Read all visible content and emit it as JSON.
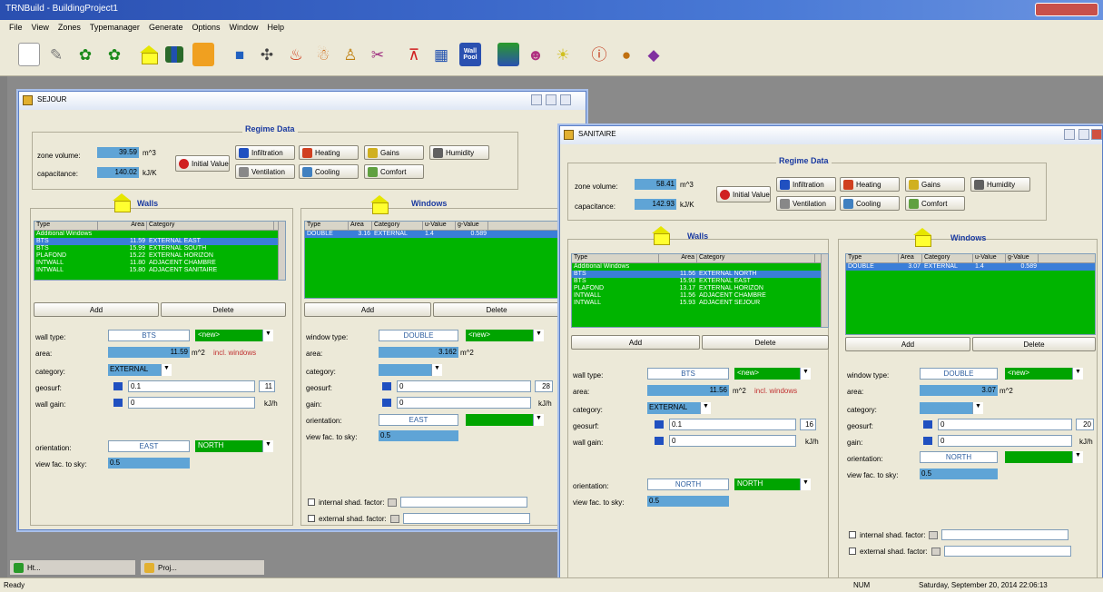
{
  "app": {
    "title": "TRNBuild - BuildingProject1"
  },
  "menu": [
    "File",
    "View",
    "Zones",
    "Typemanager",
    "Generate",
    "Options",
    "Window",
    "Help"
  ],
  "toolbar_icons": [
    "new-file-icon",
    "open-file-icon",
    "zone-green-icon",
    "zone-green-alt-icon",
    "house-yellow-icon",
    "layers-icon",
    "house-orange-icon",
    "walls-blue-icon",
    "ventilation-icon",
    "heating-fire-icon",
    "comfort-person-icon",
    "gains-lamp-icon",
    "tools-icon",
    "orientation-icon",
    "chart-icon",
    "wall-pool-icon",
    "building-icon",
    "people-icon",
    "sun-icon",
    "info-icon",
    "globe-icon",
    "help-book-icon"
  ],
  "wallpool_label": "Wall Pool",
  "sejour": {
    "title": "SEJOUR",
    "regime": {
      "title": "Regime Data",
      "zone_volume_label": "zone volume:",
      "zone_volume": "39.59",
      "volume_unit": "m^3",
      "capacitance_label": "capacitance:",
      "capacitance": "140.02",
      "capacitance_unit": "kJ/K",
      "initial_values": "Initial Values",
      "infiltration": "Infiltration",
      "ventilation": "Ventilation",
      "heating": "Heating",
      "cooling": "Cooling",
      "gains": "Gains",
      "comfort": "Comfort",
      "humidity": "Humidity"
    },
    "walls": {
      "title": "Walls",
      "columns": [
        "Type",
        "Area",
        "Category"
      ],
      "rows": [
        {
          "type": "Additional Windows",
          "area": "",
          "category": "",
          "sel": false
        },
        {
          "type": "BTS",
          "area": "11.59",
          "category": "EXTERNAL EAST",
          "sel": true
        },
        {
          "type": "BTS",
          "area": "15.99",
          "category": "EXTERNAL SOUTH",
          "sel": false
        },
        {
          "type": "PLAFOND",
          "area": "15.22",
          "category": "EXTERNAL HORIZON",
          "sel": false
        },
        {
          "type": "INTWALL",
          "area": "11.80",
          "category": "ADJACENT CHAMBRE",
          "sel": false
        },
        {
          "type": "INTWALL",
          "area": "15.80",
          "category": "ADJACENT SANITAIRE",
          "sel": false
        }
      ],
      "add": "Add",
      "delete": "Delete",
      "wall_type_label": "wall type:",
      "wall_type": "BTS",
      "dropdown_new": "<new>",
      "area_label": "area:",
      "area": "11.59",
      "area_unit": "m^2",
      "incl_windows": "incl. windows",
      "category_label": "category:",
      "category": "EXTERNAL",
      "geosurf_label": "geosurf:",
      "geosurf": "0.1",
      "geosurf_right": "11",
      "wallgain_label": "wall gain:",
      "wallgain": "0",
      "wallgain_unit": "kJ/h",
      "orientation_label": "orientation:",
      "orientation": "EAST",
      "orientation_dd": "NORTH",
      "viewfac_label": "view fac. to sky:",
      "viewfac": "0.5"
    },
    "windows": {
      "title": "Windows",
      "columns": [
        "Type",
        "Area",
        "Category",
        "u-Value",
        "g-Value"
      ],
      "rows": [
        {
          "type": "DOUBLE",
          "area": "3.16",
          "category": "EXTERNAL",
          "u": "1.4",
          "g": "0.589",
          "sel": true
        }
      ],
      "add": "Add",
      "delete": "Delete",
      "window_type_label": "window type:",
      "window_type": "DOUBLE",
      "dropdown_new": "<new>",
      "area_label": "area:",
      "area": "3.162",
      "area_unit": "m^2",
      "category_label": "category:",
      "category": "EXTERNAL",
      "geosurf_label": "geosurf:",
      "geosurf": "0",
      "geosurf_right": "28",
      "gain_label": "gain:",
      "gain": "0",
      "gain_unit": "kJ/h",
      "orientation_label": "orientation:",
      "orientation": "EAST",
      "orientation_dd": "EAST",
      "viewfac_label": "view fac. to sky:",
      "viewfac": "0.5",
      "internal_shad": "internal shad. factor:",
      "external_shad": "external shad. factor:"
    }
  },
  "sanitaire": {
    "title": "SANITAIRE",
    "regime": {
      "title": "Regime Data",
      "zone_volume_label": "zone volume:",
      "zone_volume": "58.41",
      "volume_unit": "m^3",
      "capacitance_label": "capacitance:",
      "capacitance": "142.93",
      "capacitance_unit": "kJ/K",
      "initial_values": "Initial Values",
      "infiltration": "Infiltration",
      "ventilation": "Ventilation",
      "heating": "Heating",
      "cooling": "Cooling",
      "gains": "Gains",
      "comfort": "Comfort",
      "humidity": "Humidity"
    },
    "walls": {
      "title": "Walls",
      "columns": [
        "Type",
        "Area",
        "Category"
      ],
      "rows": [
        {
          "type": "Additional Windows",
          "area": "",
          "category": "",
          "sel": false
        },
        {
          "type": "BTS",
          "area": "11.56",
          "category": "EXTERNAL NORTH",
          "sel": true
        },
        {
          "type": "BTS",
          "area": "15.93",
          "category": "EXTERNAL EAST",
          "sel": false
        },
        {
          "type": "PLAFOND",
          "area": "13.17",
          "category": "EXTERNAL HORIZON",
          "sel": false
        },
        {
          "type": "INTWALL",
          "area": "11.56",
          "category": "ADJACENT CHAMBRE",
          "sel": false
        },
        {
          "type": "INTWALL",
          "area": "15.93",
          "category": "ADJACENT SEJOUR",
          "sel": false
        }
      ],
      "add": "Add",
      "delete": "Delete",
      "wall_type_label": "wall type:",
      "wall_type": "BTS",
      "dropdown_new": "<new>",
      "area_label": "area:",
      "area": "11.56",
      "area_unit": "m^2",
      "incl_windows": "incl. windows",
      "category_label": "category:",
      "category": "EXTERNAL",
      "geosurf_label": "geosurf:",
      "geosurf": "0.1",
      "geosurf_right": "16",
      "wallgain_label": "wall gain:",
      "wallgain": "0",
      "wallgain_unit": "kJ/h",
      "orientation_label": "orientation:",
      "orientation": "NORTH",
      "orientation_dd": "NORTH",
      "viewfac_label": "view fac. to sky:",
      "viewfac": "0.5"
    },
    "windows": {
      "title": "Windows",
      "columns": [
        "Type",
        "Area",
        "Category",
        "u-Value",
        "g-Value"
      ],
      "rows": [
        {
          "type": "DOUBLE",
          "area": "3.07",
          "category": "EXTERNAL",
          "u": "1.4",
          "g": "0.589",
          "sel": true
        }
      ],
      "add": "Add",
      "delete": "Delete",
      "window_type_label": "window type:",
      "window_type": "DOUBLE",
      "dropdown_new": "<new>",
      "area_label": "area:",
      "area": "3.07",
      "area_unit": "m^2",
      "category_label": "category:",
      "category": "EXTERNAL",
      "geosurf_label": "geosurf:",
      "geosurf": "0",
      "geosurf_right": "20",
      "gain_label": "gain:",
      "gain": "0",
      "gain_unit": "kJ/h",
      "orientation_label": "orientation:",
      "orientation": "NORTH",
      "orientation_dd": "NORTH",
      "viewfac_label": "view fac. to sky:",
      "viewfac": "0.5",
      "internal_shad": "internal shad. factor:",
      "external_shad": "external shad. factor:"
    }
  },
  "taskbar": [
    {
      "label": "Ht..."
    },
    {
      "label": "Proj..."
    }
  ],
  "status": {
    "ready": "Ready",
    "num": "NUM",
    "datetime": "Saturday, September 20, 2014   22:06:13"
  }
}
